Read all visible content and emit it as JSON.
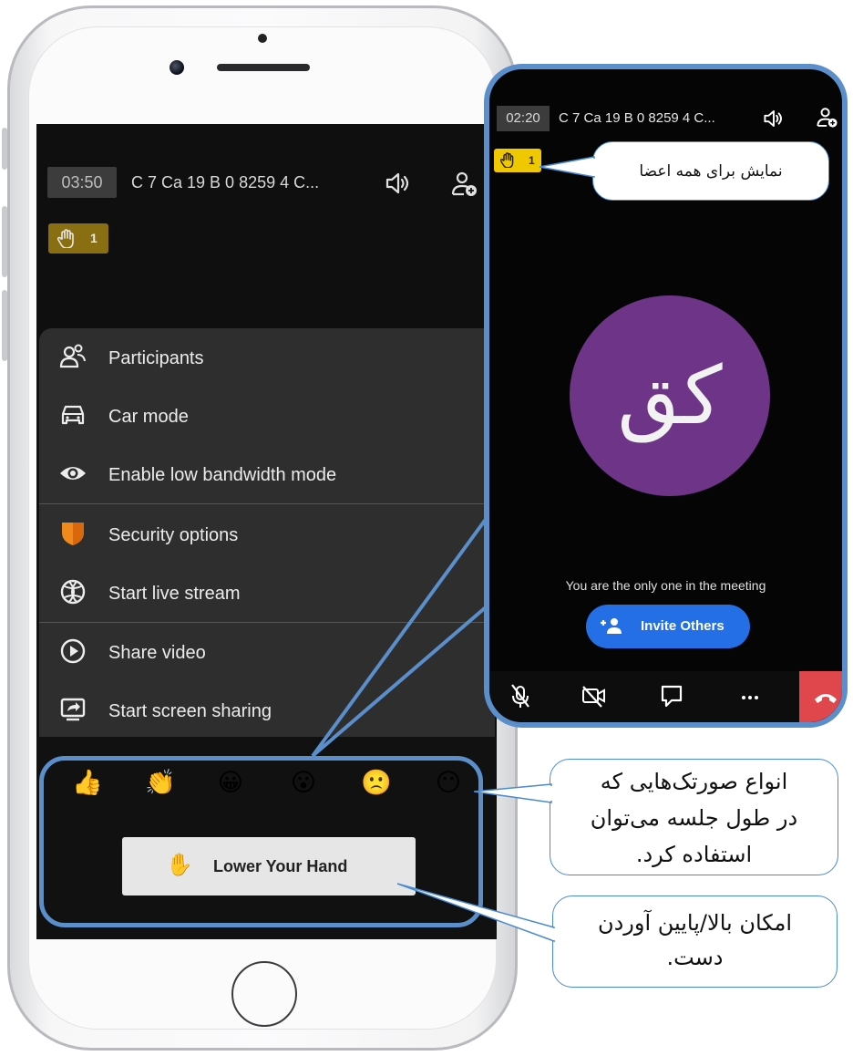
{
  "phone": {
    "meeting": {
      "timer": "03:50",
      "title": "C 7 Ca 19 B 0 8259 4 C...",
      "raised_hands_count": "1"
    },
    "menu": {
      "items": [
        {
          "label": "Participants",
          "icon": "participants-icon"
        },
        {
          "label": "Car mode",
          "icon": "car-icon"
        },
        {
          "label": "Enable low bandwidth mode",
          "icon": "eye-icon"
        },
        {
          "label": "Security options",
          "icon": "shield-icon"
        },
        {
          "label": "Start live stream",
          "icon": "globe-icon"
        },
        {
          "label": "Share video",
          "icon": "play-circle-icon"
        },
        {
          "label": "Start screen sharing",
          "icon": "screen-share-icon"
        }
      ]
    },
    "reactions": {
      "emojis": [
        "👍",
        "👏",
        "😀",
        "😮",
        "🙁",
        "😶"
      ],
      "lower_hand_icon": "✋",
      "lower_hand_label": "Lower Your Hand"
    }
  },
  "inset": {
    "timer": "02:20",
    "title": "C 7 Ca 19 B 0 8259 4 C...",
    "raised_hands_count": "1",
    "avatar_initials": "کق",
    "avatar_color": "#6d3488",
    "only_one_text": "You are the only one in the meeting",
    "invite_label": "Invite Others",
    "invite_color": "#246fe5",
    "hangup_color": "#e0474c"
  },
  "callouts": {
    "members": "نمایش برای همه اعضا",
    "reactions_line1": "انواع صورتک‌هایی که",
    "reactions_line2": "در طول جلسه می‌توان",
    "reactions_line3": "استفاده کرد.",
    "hand_line1": "امکان بالا/پایین آوردن",
    "hand_line2": "دست."
  },
  "colors": {
    "highlight_frame": "#5a8fcb",
    "hand_badge_dim": "#8a6f12",
    "hand_badge_bright": "#f0c800"
  }
}
